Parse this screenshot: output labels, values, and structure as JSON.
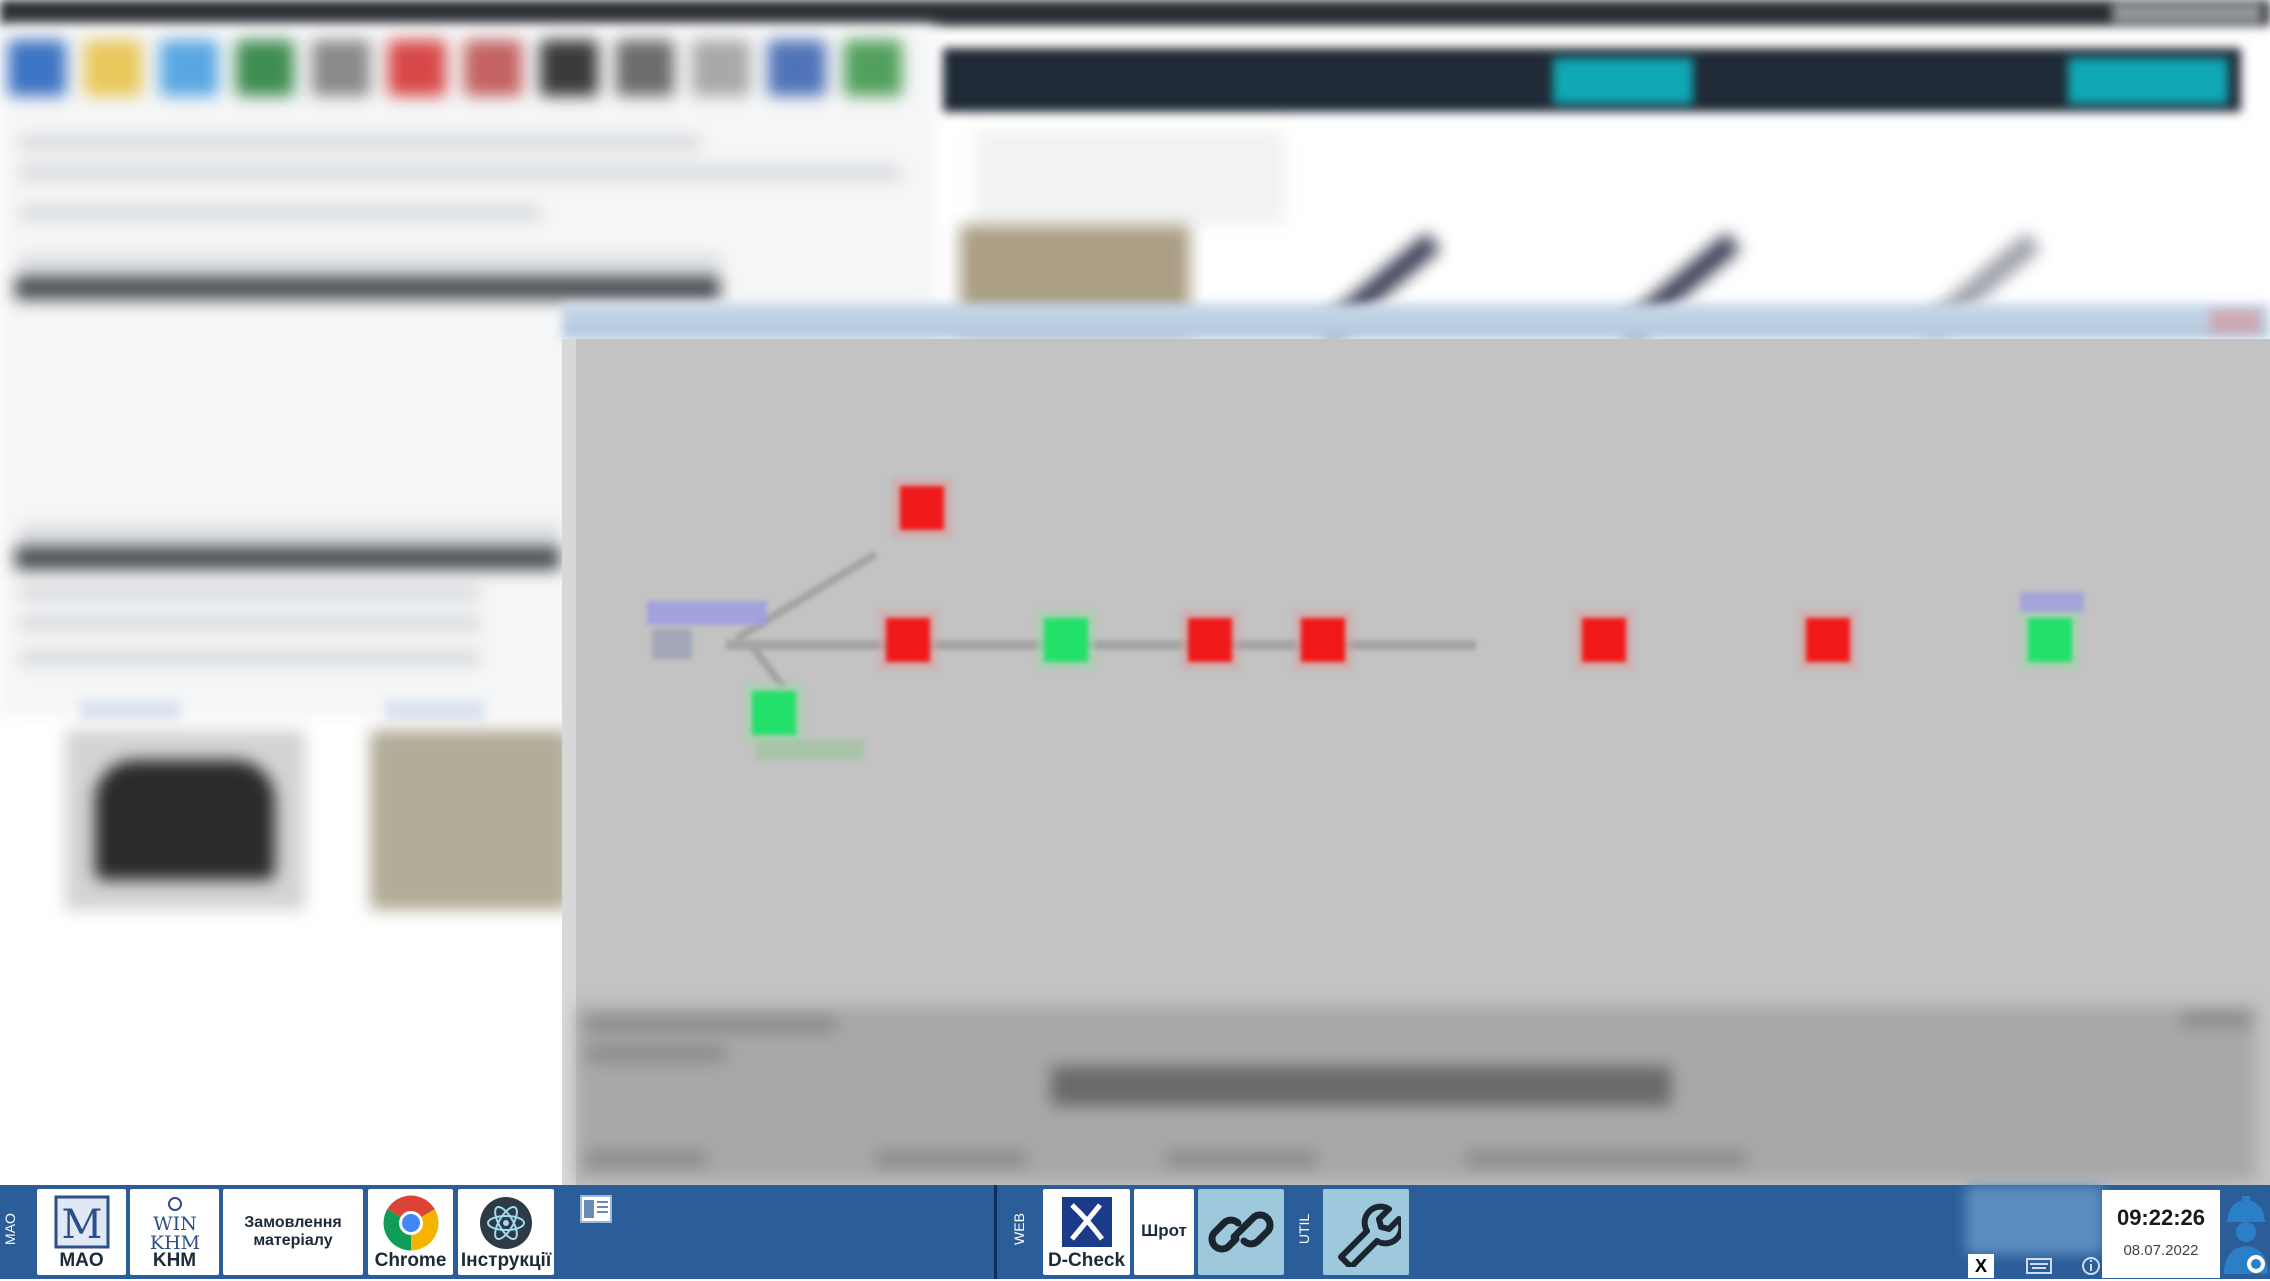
{
  "taskbar": {
    "left_group_label": "MAO",
    "web_group_label": "WEB",
    "util_group_label": "UTIL",
    "apps": [
      {
        "name": "mao",
        "label": "MAO",
        "icon": "mao-logo-icon"
      },
      {
        "name": "khm",
        "label": "KHM",
        "icon": "win-khm-logo-icon"
      },
      {
        "name": "order",
        "label": "Замовлення матеріалу"
      },
      {
        "name": "chrome",
        "label": "Chrome",
        "icon": "chrome-icon"
      },
      {
        "name": "instructions",
        "label": "Інструкції",
        "icon": "atom-icon"
      }
    ],
    "web_apps": [
      {
        "name": "dcheck",
        "label": "D-Check",
        "icon": "dcheck-logo-icon"
      },
      {
        "name": "shrot",
        "label": "Шрот"
      }
    ],
    "util_apps": [
      {
        "name": "link",
        "icon": "link-icon"
      },
      {
        "name": "wrench",
        "icon": "wrench-icon"
      }
    ],
    "tray_close": "X",
    "clock": {
      "time": "09:22:26",
      "date": "08.07.2022"
    }
  },
  "graph": {
    "colors": {
      "ok": "#22e06a",
      "fail": "#f01818",
      "edge": "#a4a4a4"
    },
    "nodes": [
      {
        "id": "n-upper",
        "status": "fail"
      },
      {
        "id": "n1",
        "status": "fail"
      },
      {
        "id": "n2",
        "status": "ok"
      },
      {
        "id": "n3",
        "status": "fail"
      },
      {
        "id": "n4",
        "status": "fail"
      },
      {
        "id": "n5",
        "status": "fail"
      },
      {
        "id": "n6",
        "status": "fail"
      },
      {
        "id": "n-end",
        "status": "ok"
      },
      {
        "id": "n-lower",
        "status": "ok"
      }
    ]
  }
}
